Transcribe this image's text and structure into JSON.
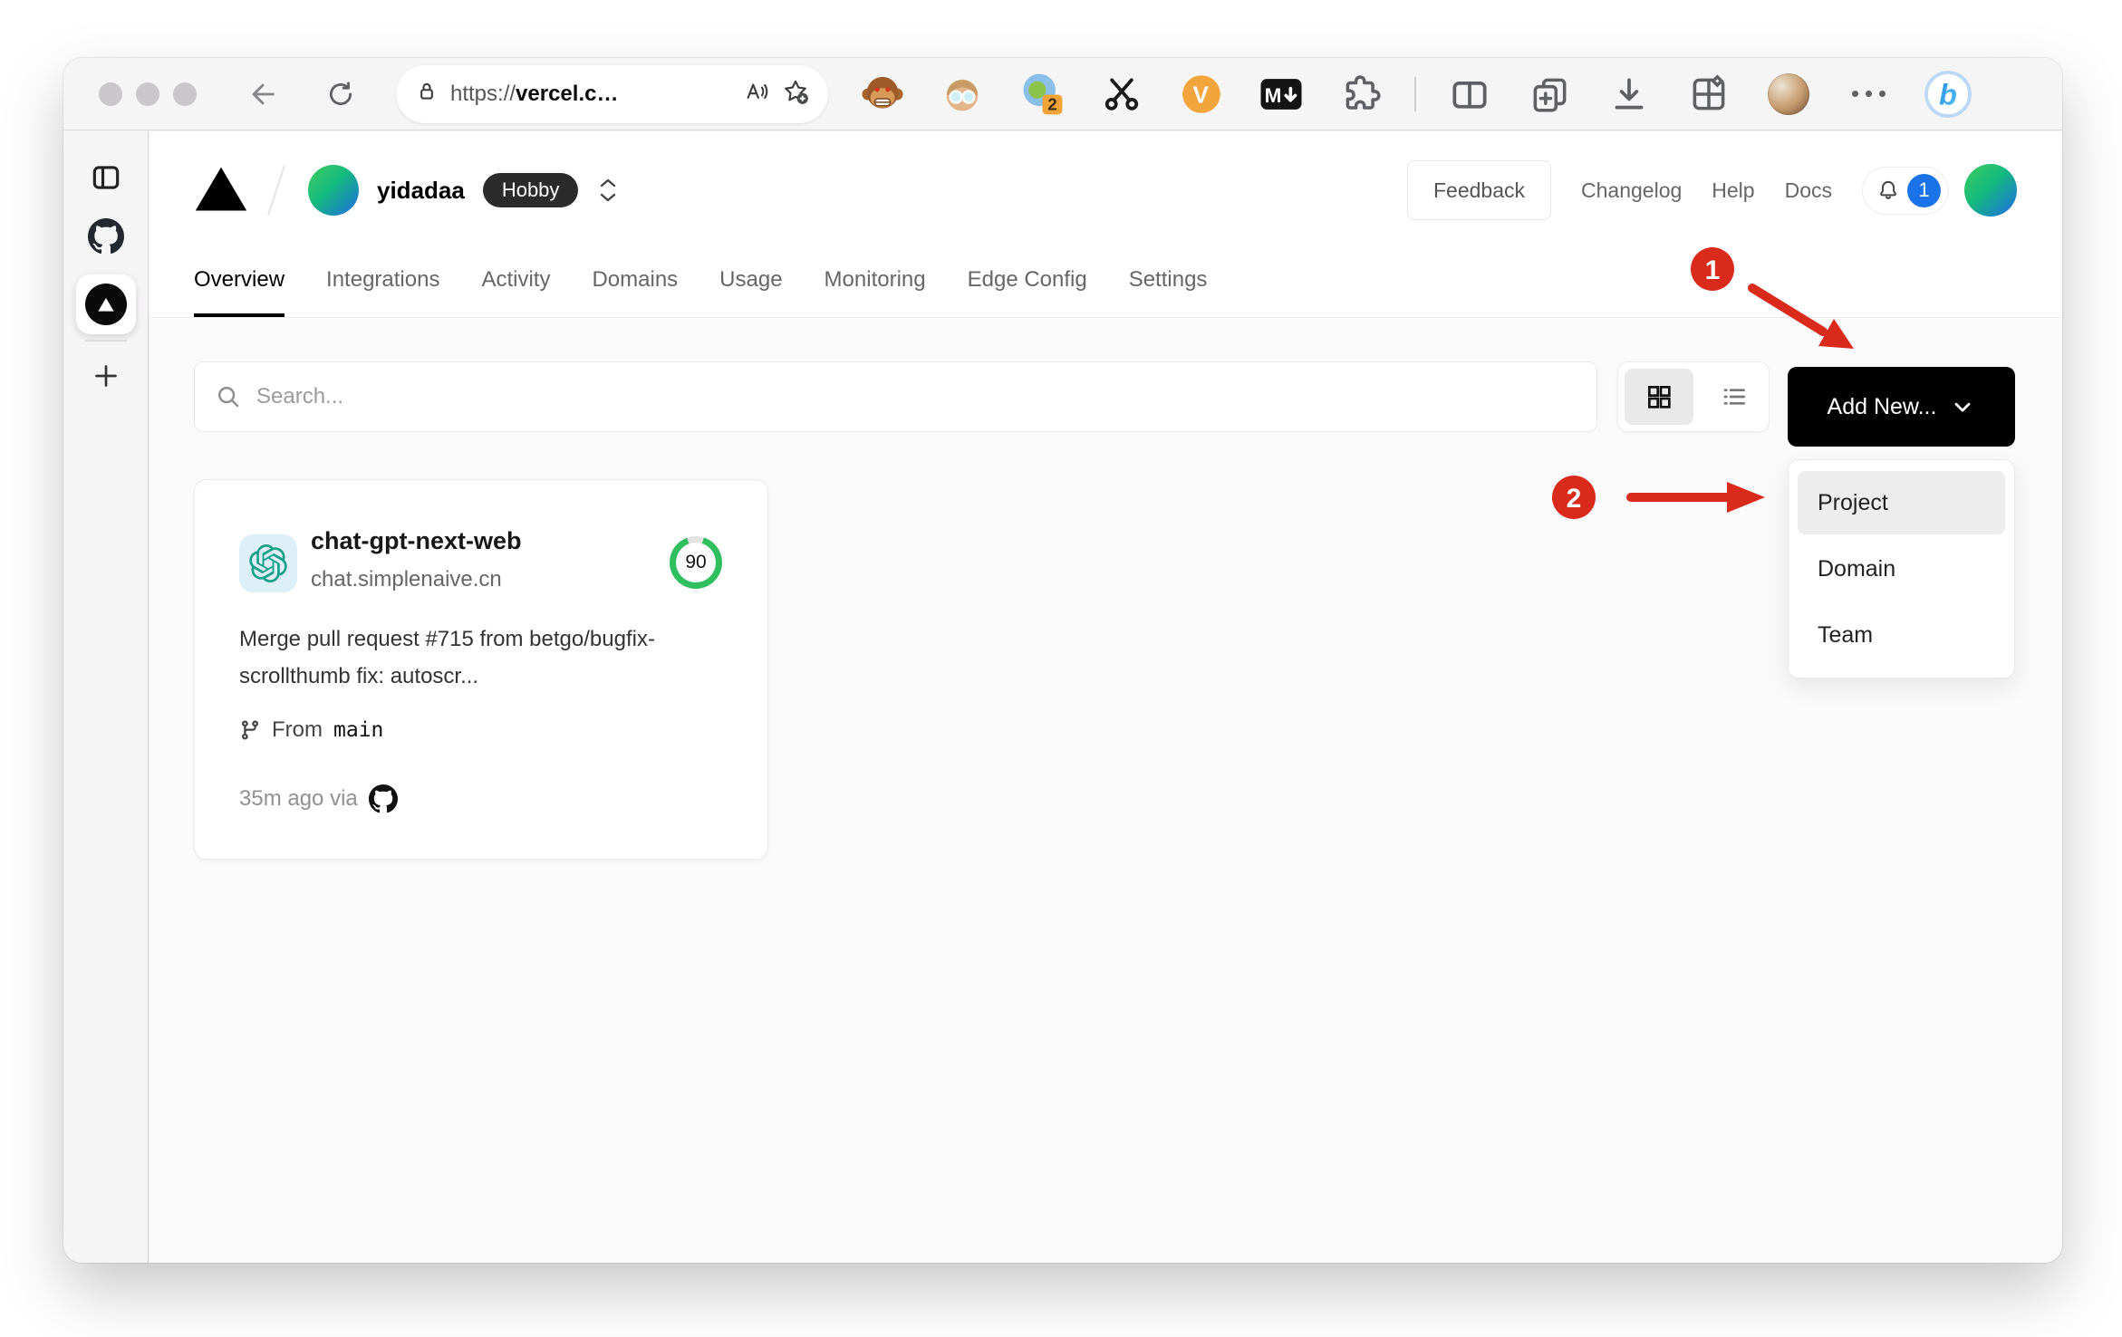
{
  "browser": {
    "url": {
      "scheme": "https://",
      "host": "vercel.c…"
    },
    "ext_badge": "2",
    "markdown_label": "M",
    "v_label": "V",
    "copilot_label": "b"
  },
  "header": {
    "team": "yidadaa",
    "badge": "Hobby",
    "feedback": "Feedback",
    "links": [
      {
        "label": "Changelog"
      },
      {
        "label": "Help"
      },
      {
        "label": "Docs"
      }
    ],
    "notifications": "1"
  },
  "tabs": [
    {
      "label": "Overview",
      "active": true
    },
    {
      "label": "Integrations"
    },
    {
      "label": "Activity"
    },
    {
      "label": "Domains"
    },
    {
      "label": "Usage"
    },
    {
      "label": "Monitoring"
    },
    {
      "label": "Edge Config"
    },
    {
      "label": "Settings"
    }
  ],
  "toolbar": {
    "search_placeholder": "Search...",
    "add_new": "Add New..."
  },
  "dropdown": {
    "items": [
      {
        "label": "Project",
        "highlighted": true
      },
      {
        "label": "Domain"
      },
      {
        "label": "Team"
      }
    ]
  },
  "card": {
    "name": "chat-gpt-next-web",
    "domain": "chat.simplenaive.cn",
    "score": "90",
    "commit": "Merge pull request #715 from betgo/bugfix-scrollthumb fix: autoscr...",
    "from_label": "From",
    "branch": "main",
    "meta": "35m ago via"
  },
  "annotations": {
    "step1": "1",
    "step2": "2"
  },
  "colors": {
    "accent_red": "#d92a1b",
    "score_green": "#2fbf5f",
    "notification_blue": "#1a73e8",
    "avatar_gradient": [
      "#3ecf5e",
      "#1e6be6"
    ],
    "button_black": "#000000",
    "content_bg": "#fafafa"
  }
}
